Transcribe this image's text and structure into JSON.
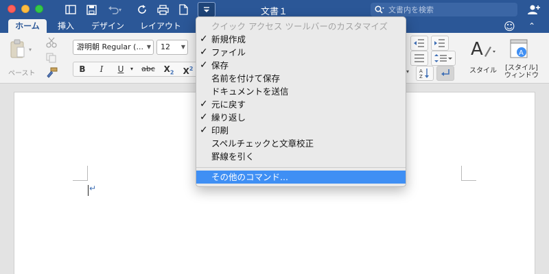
{
  "window": {
    "title": "文書１",
    "search_placeholder": "文書内を検索"
  },
  "tabs": [
    {
      "label": "ホーム",
      "active": true
    },
    {
      "label": "挿入"
    },
    {
      "label": "デザイン"
    },
    {
      "label": "レイアウト"
    }
  ],
  "ribbon": {
    "paste_label": "ペースト",
    "font_name": "游明朝 Regular (...",
    "font_size": "12",
    "style_label": "スタイル",
    "style_window_line1": "[スタイル]",
    "style_window_line2": "ウィンドウ"
  },
  "menu": {
    "header": "クイック アクセス ツールバーのカスタマイズ",
    "items": [
      {
        "label": "新規作成",
        "checked": true
      },
      {
        "label": "ファイル",
        "checked": true
      },
      {
        "label": "保存",
        "checked": true
      },
      {
        "label": "名前を付けて保存",
        "checked": false
      },
      {
        "label": "ドキュメントを送信",
        "checked": false
      },
      {
        "label": "元に戻す",
        "checked": true
      },
      {
        "label": "繰り返し",
        "checked": true
      },
      {
        "label": "印刷",
        "checked": true
      },
      {
        "label": "スペルチェックと文章校正",
        "checked": false
      },
      {
        "label": "罫線を引く",
        "checked": false
      }
    ],
    "more_commands": "その他のコマンド..."
  },
  "document": {
    "paragraph_mark": "↵"
  }
}
